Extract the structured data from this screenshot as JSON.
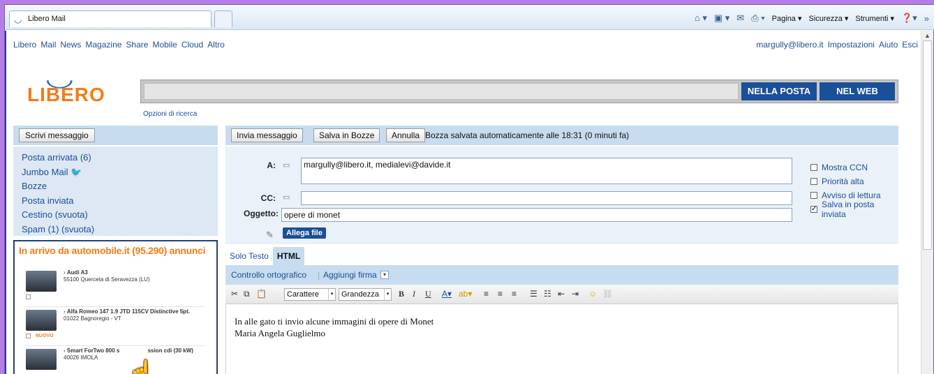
{
  "browser": {
    "tab_title": "Libero Mail",
    "commands": [
      "Pagina",
      "Sicurezza",
      "Strumenti"
    ]
  },
  "nav": {
    "links": [
      "Libero",
      "Mail",
      "News",
      "Magazine",
      "Share",
      "Mobile",
      "Cloud",
      "Altro"
    ],
    "user_email": "margully@libero.it",
    "settings": "Impostazioni",
    "help": "Aiuto",
    "logout": "Esci"
  },
  "logo": {
    "text": "LIBERO"
  },
  "search": {
    "btn_mail": "NELLA POSTA",
    "btn_web": "NEL WEB",
    "options": "Opzioni di ricerca"
  },
  "sidebar": {
    "compose_label": "Scrivi messaggio",
    "folders": [
      {
        "label": "Posta arrivata (6)"
      },
      {
        "label": "Jumbo Mail"
      },
      {
        "label": "Bozze"
      },
      {
        "label": "Posta inviata"
      },
      {
        "label": "Cestino  (svuota)"
      },
      {
        "label": "Spam (1)  (svuota)"
      }
    ]
  },
  "ad": {
    "title": "In arrivo da automobile.it (95.290) annunci",
    "cars": [
      {
        "name": "Audi A3",
        "location": "55100 Querceta di Seravezza (LU)"
      },
      {
        "name": "Alfa Romeo 147 1.9 JTD 115CV Distinctive 5pt.",
        "location": "01022 Bagnoregio - VT",
        "badge": "NUOVO"
      },
      {
        "name": "Smart ForTwo 800 s",
        "name_tail": "ssion cdi (30 kW)",
        "location": "40026 IMOLA"
      }
    ]
  },
  "compose": {
    "send": "Invia messaggio",
    "save_draft": "Salva in Bozze",
    "cancel": "Annulla",
    "autosave_msg": "Bozza salvata automaticamente alle 18:31 (0 minuti fa)",
    "to_label": "A:",
    "to_value": "margully@libero.it, medialevi@davide.it",
    "cc_label": "CC:",
    "cc_value": "",
    "subject_label": "Oggetto:",
    "subject_value": "opere di monet",
    "attach": "Allega file",
    "options": [
      {
        "label": "Mostra CCN",
        "checked": false
      },
      {
        "label": "Priorità alta",
        "checked": false
      },
      {
        "label": "Avviso di lettura",
        "checked": false
      },
      {
        "label": "Salva in posta inviata",
        "checked": true
      }
    ],
    "mode_tabs": [
      "Solo Testo",
      "HTML"
    ],
    "spellcheck": "Controllo ortografico",
    "add_signature": "Aggiungi firma",
    "font_select": "Carattere",
    "size_select": "Grandezza",
    "body_lines": [
      "In alle gato ti invio alcune immagini di opere di Monet",
      "Maria Angela Guglielmo"
    ]
  }
}
